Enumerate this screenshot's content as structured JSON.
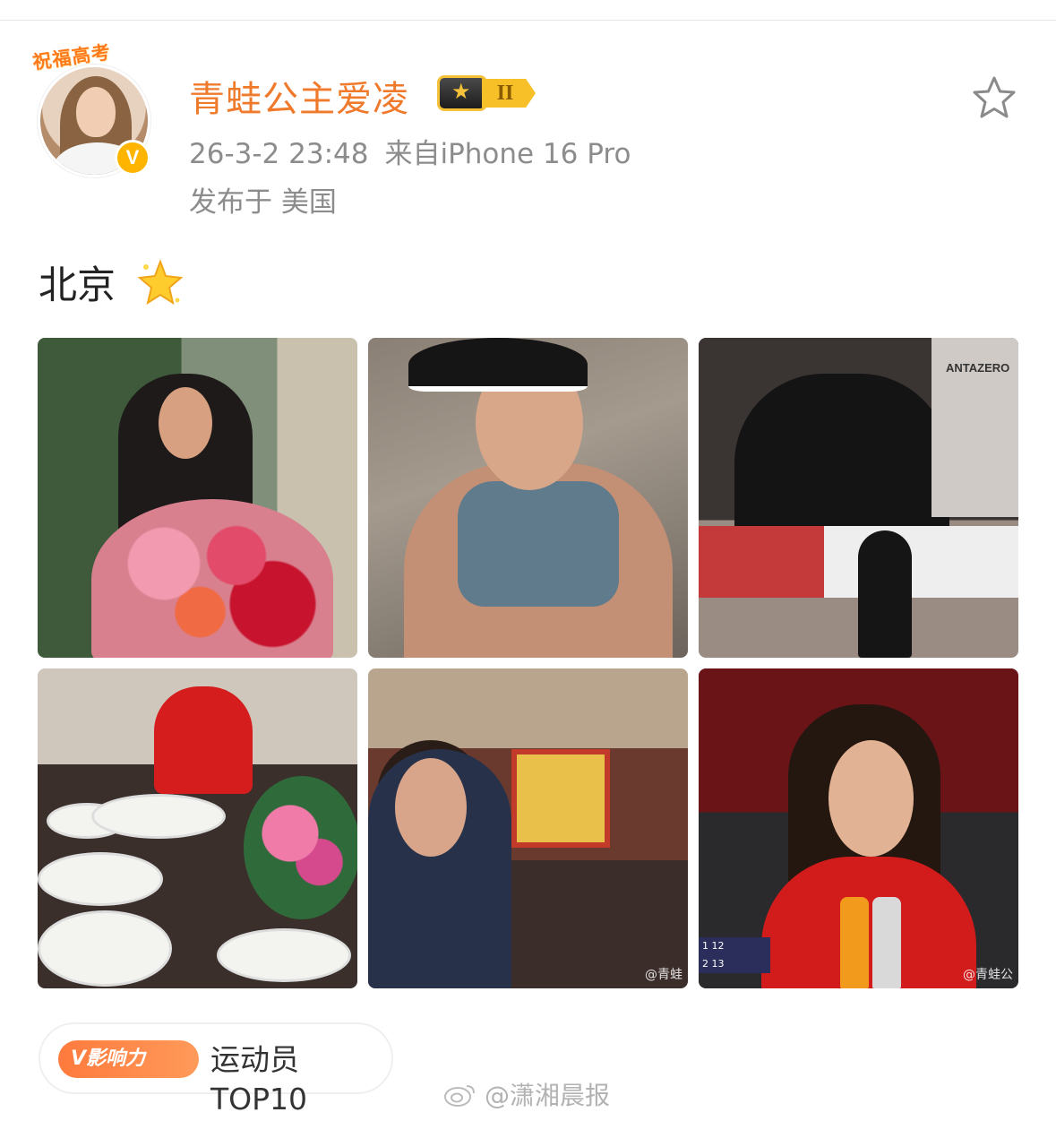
{
  "post": {
    "avatar_banner": "祝福高考",
    "verified_badge": "V",
    "username": "青蛙公主爱凌",
    "level_badge": "II",
    "timestamp": "26-3-2 23:48",
    "source": "来自iPhone 16 Pro",
    "location": "发布于 美国",
    "text": "北京",
    "sparkle_icon": "sparkle-star-icon"
  },
  "photos": [
    {
      "alt": "photo-flowers-bouquet"
    },
    {
      "alt": "photo-gym-selfie"
    },
    {
      "alt": "photo-street-billboard",
      "brand": "ANTAZERO"
    },
    {
      "alt": "photo-dinner-table"
    },
    {
      "alt": "photo-restaurant-stage",
      "watermark": "@青蛙"
    },
    {
      "alt": "photo-stadium-red-jacket",
      "watermark": "@青蛙公",
      "score_rows": [
        "1 12",
        "2 13"
      ]
    }
  ],
  "influence": {
    "badge": "V影响力",
    "label": "运动员TOP10"
  },
  "watermark": {
    "text": "@潇湘晨报"
  },
  "colors": {
    "username": "#f07a2c",
    "meta": "#8c8c8c",
    "badge_orange": "#ff7a3d",
    "verified": "#ffb400"
  }
}
